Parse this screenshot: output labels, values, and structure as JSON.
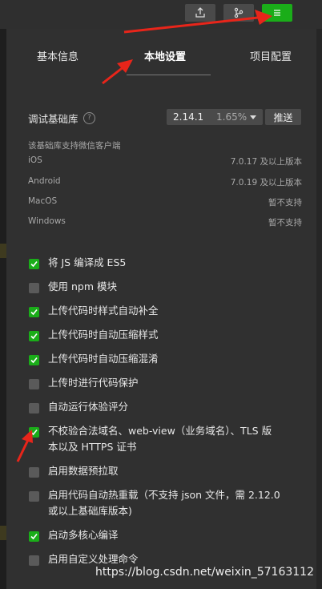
{
  "toolbar": {
    "buttons": [
      {
        "icon": "upload-icon"
      },
      {
        "icon": "branch-icon"
      },
      {
        "icon": "menu-icon",
        "active": true
      }
    ]
  },
  "tabs": [
    "基本信息",
    "本地设置",
    "项目配置"
  ],
  "active_tab": "本地设置",
  "sdk": {
    "label": "调试基础库",
    "version": "2.14.1",
    "usage": "1.65%",
    "push_label": "推送",
    "hint": "该基础库支持微信客户端",
    "platforms": [
      {
        "name": "iOS",
        "value": "7.0.17 及以上版本"
      },
      {
        "name": "Android",
        "value": "7.0.19 及以上版本"
      },
      {
        "name": "MacOS",
        "value": "暂不支持"
      },
      {
        "name": "Windows",
        "value": "暂不支持"
      }
    ]
  },
  "options": [
    {
      "label": "将 JS 编译成 ES5",
      "checked": true
    },
    {
      "label": "使用 npm 模块",
      "checked": false
    },
    {
      "label": "上传代码时样式自动补全",
      "checked": true
    },
    {
      "label": "上传代码时自动压缩样式",
      "checked": true
    },
    {
      "label": "上传代码时自动压缩混淆",
      "checked": true
    },
    {
      "label": "上传时进行代码保护",
      "checked": false
    },
    {
      "label": "自动运行体验评分",
      "checked": false
    },
    {
      "label_line1": "不校验合法域名、web-view（业务域名）、TLS 版",
      "label_line2": "本以及 HTTPS 证书",
      "checked": true
    },
    {
      "label": "启用数据预拉取",
      "checked": false
    },
    {
      "label_line1": "启用代码自动热重载（不支持 json 文件，需 2.12.0",
      "label_line2": "或以上基础库版本)",
      "checked": false
    },
    {
      "label": "启动多核心编译",
      "checked": true
    },
    {
      "label": "启用自定义处理命令",
      "checked": false
    }
  ],
  "watermark": "https://blog.csdn.net/weixin_57163112",
  "colors": {
    "accent": "#1aad19",
    "annotation_arrow": "#e8251a"
  }
}
